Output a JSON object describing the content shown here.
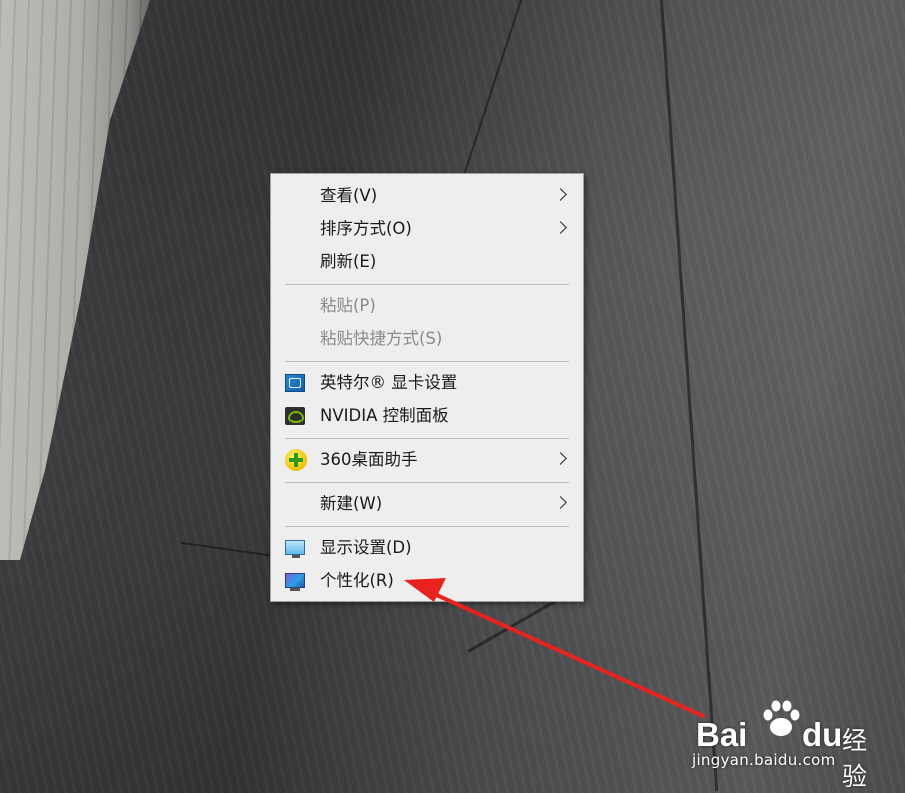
{
  "context_menu": {
    "items": [
      {
        "label": "查看(V)",
        "has_submenu": true,
        "enabled": true
      },
      {
        "label": "排序方式(O)",
        "has_submenu": true,
        "enabled": true
      },
      {
        "label": "刷新(E)",
        "has_submenu": false,
        "enabled": true
      },
      {
        "label": "粘贴(P)",
        "has_submenu": false,
        "enabled": false
      },
      {
        "label": "粘贴快捷方式(S)",
        "has_submenu": false,
        "enabled": false
      },
      {
        "label": "英特尔® 显卡设置",
        "icon": "intel-graphics-icon",
        "has_submenu": false,
        "enabled": true
      },
      {
        "label": "NVIDIA 控制面板",
        "icon": "nvidia-icon",
        "has_submenu": false,
        "enabled": true
      },
      {
        "label": "360桌面助手",
        "icon": "360-assistant-icon",
        "has_submenu": true,
        "enabled": true
      },
      {
        "label": "新建(W)",
        "has_submenu": true,
        "enabled": true
      },
      {
        "label": "显示设置(D)",
        "icon": "display-settings-icon",
        "has_submenu": false,
        "enabled": true
      },
      {
        "label": "个性化(R)",
        "icon": "personalize-icon",
        "has_submenu": false,
        "enabled": true
      }
    ]
  },
  "annotation": {
    "type": "red-arrow",
    "points_to": "个性化(R)",
    "color": "#e8231f"
  },
  "watermark": {
    "logo_left": "Bai",
    "logo_right": "du",
    "brand_suffix": "经验",
    "url": "jingyan.baidu.com"
  },
  "colors": {
    "menu_background": "#eeeeee",
    "menu_text": "#1a1a1a",
    "disabled_text": "#8a8a8a",
    "arrow": "#e8231f"
  }
}
